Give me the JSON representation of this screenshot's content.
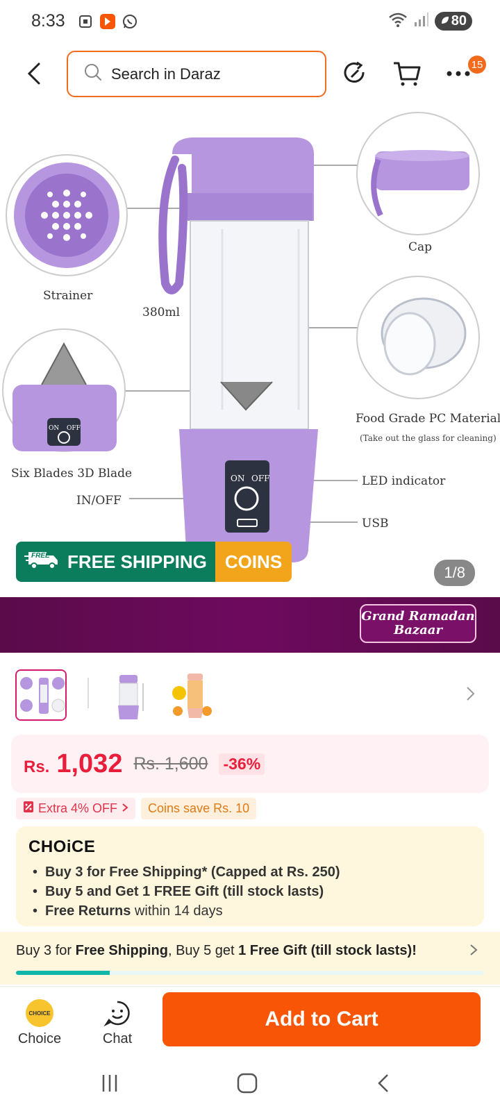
{
  "status_bar": {
    "time": "8:33",
    "battery": "80"
  },
  "search": {
    "placeholder": "Search in Daraz"
  },
  "header": {
    "more_badge": "15"
  },
  "product_image": {
    "labels": {
      "strainer": "Strainer",
      "capacity": "380ml",
      "cap": "Cap",
      "blade": "Six Blades 3D Blade",
      "inoff": "IN/OFF",
      "material": "Food Grade PC Material",
      "material_note": "(Take out the glass for cleaning)",
      "led": "LED indicator",
      "usb": "USB",
      "switch_on": "ON",
      "switch_off": "OFF"
    },
    "free_shipping_label": "FREE SHIPPING",
    "free_tag": "FREE",
    "coins_label": "COINS",
    "counter": "1/8"
  },
  "ramadan": {
    "line1": "Grand Ramadan",
    "line2": "Bazaar"
  },
  "price": {
    "currency": "Rs.",
    "current": "1,032",
    "original": "Rs. 1,600",
    "discount": "-36%"
  },
  "promos": {
    "extra_off": "Extra 4% OFF",
    "coins_save": "Coins save Rs. 10"
  },
  "choice": {
    "logo": "CHOiCE",
    "items": [
      {
        "bold": "Buy 3 for  Free Shipping* (Capped at Rs. 250)",
        "rest": ""
      },
      {
        "bold": "Buy 5 and Get 1 FREE Gift (till stock lasts)",
        "rest": ""
      },
      {
        "bold": "Free Returns",
        "rest": " within 14 days"
      }
    ]
  },
  "free_ship_bar": {
    "part1": "Buy 3 for ",
    "part2": "Free Shipping",
    "part3": ", Buy 5 get ",
    "part4": "1 Free Gift (till stock lasts)!",
    "progress": 0.2
  },
  "action_bar": {
    "choice_label": "Choice",
    "choice_coin_text": "CHOICE",
    "chat_label": "Chat",
    "add_to_cart": "Add to Cart"
  },
  "colors": {
    "accent": "#f85606",
    "price": "#e91e3a",
    "shipping_green": "#0c7d5c",
    "coins_yellow": "#f2a51a",
    "ramadan_purple": "#6e0a5e"
  }
}
